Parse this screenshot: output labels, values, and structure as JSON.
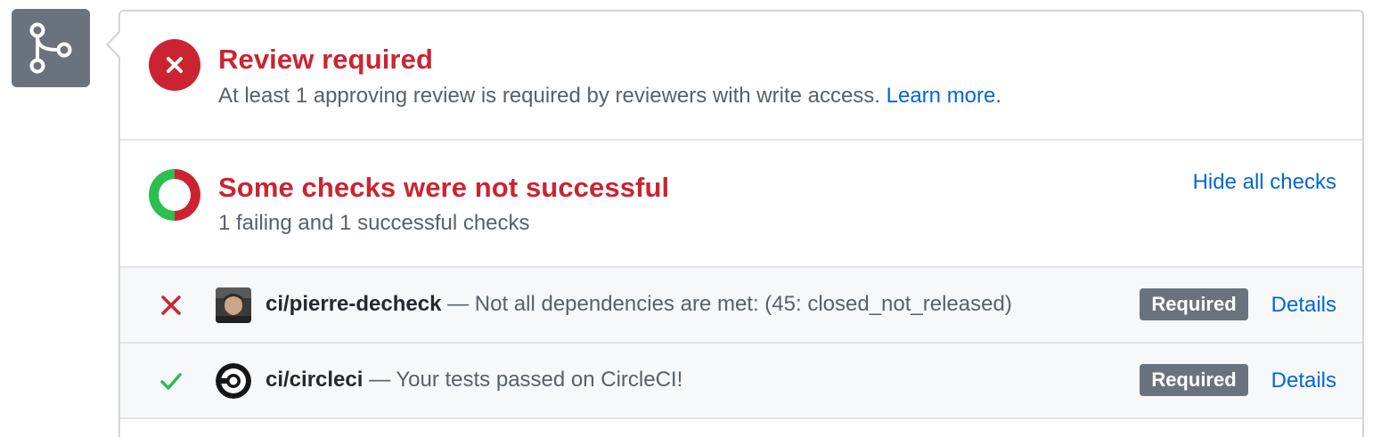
{
  "merge_icon": "git-merge-icon",
  "review": {
    "icon": "x-circle-icon",
    "title": "Review required",
    "description": "At least 1 approving review is required by reviewers with write access.",
    "learn_more": "Learn more."
  },
  "checks": {
    "icon": "partial-status-ring-icon",
    "title": "Some checks were not successful",
    "summary": "1 failing and 1 successful checks",
    "toggle_label": "Hide all checks",
    "items": [
      {
        "status": "failure",
        "status_icon": "x-icon",
        "avatar": "user-avatar",
        "context": "ci/pierre-decheck",
        "description": "— Not all dependencies are met: (45: closed_not_released)",
        "badge": "Required",
        "details_label": "Details"
      },
      {
        "status": "success",
        "status_icon": "check-icon",
        "avatar": "circleci-logo-icon",
        "context": "ci/circleci",
        "description": "— Your tests passed on CircleCI!",
        "badge": "Required",
        "details_label": "Details"
      }
    ]
  },
  "colors": {
    "failure": "#cb2431",
    "success": "#2cbe4e",
    "link": "#0366d6",
    "badge": "#6a737d"
  }
}
